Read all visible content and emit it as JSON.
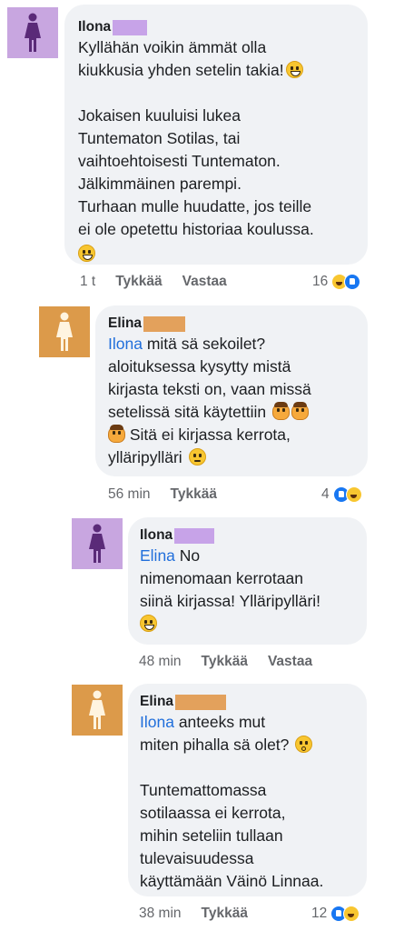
{
  "colors": {
    "ilona_avatar_bg": "#c8a6e0",
    "ilona_figure": "#5a2a78",
    "ilona_redact": "#c7a3e8",
    "elina_avatar_bg": "#dc9a4a",
    "elina_figure": "#fff4e0",
    "elina_redact": "#e3a15c",
    "mention": "#216fdb",
    "bubble": "#f0f2f5"
  },
  "comments": [
    {
      "author": "Ilona",
      "avatar": "female-silhouette-icon",
      "p1": "Kyllähän voikin ämmät olla\nkiukkusia yhden setelin takia!",
      "p2": "Jokaisen kuuluisi lukea\nTuntematon Sotilas, tai\nvaihtoehtoisesti Tuntematon.\nJälkimmäinen parempi.\nTurhaan mulle huudatte, jos teille\nei ole opetettu historiaa koulussa.",
      "time": "1 t",
      "like": "Tykkää",
      "reply": "Vastaa",
      "reaction_count": "16"
    },
    {
      "author": "Elina",
      "avatar": "female-silhouette-icon",
      "mention": "Ilona",
      "p1_after_mention": " mitä sä sekoilet?\naloituksessa kysytty mistä\nkirjasta teksti on, vaan missä\nsetelissä sitä käytettiin",
      "p1_line5": "Sitä ei kirjassa kerrota,",
      "p1_line6": "ylläripylläri",
      "time": "56 min",
      "like": "Tykkää",
      "reaction_count": "4"
    },
    {
      "author": "Ilona",
      "avatar": "female-silhouette-icon",
      "mention": "Elina",
      "p1_after_mention": " No\nnimenomaan kerrotaan\nsiinä kirjassa! Ylläripylläri!",
      "time": "48 min",
      "like": "Tykkää",
      "reply": "Vastaa"
    },
    {
      "author": "Elina",
      "avatar": "female-silhouette-icon",
      "mention": "Ilona",
      "p1_after_mention": " anteeks mut\nmiten pihalla sä olet?",
      "p2": "Tuntemattomassa\nsotilaassa ei kerrota,\nmihin seteliin tullaan\ntulevaisuudessa\nkäyttämään Väinö Linnaa.",
      "time": "38 min",
      "like": "Tykkää",
      "reaction_count": "12"
    }
  ]
}
